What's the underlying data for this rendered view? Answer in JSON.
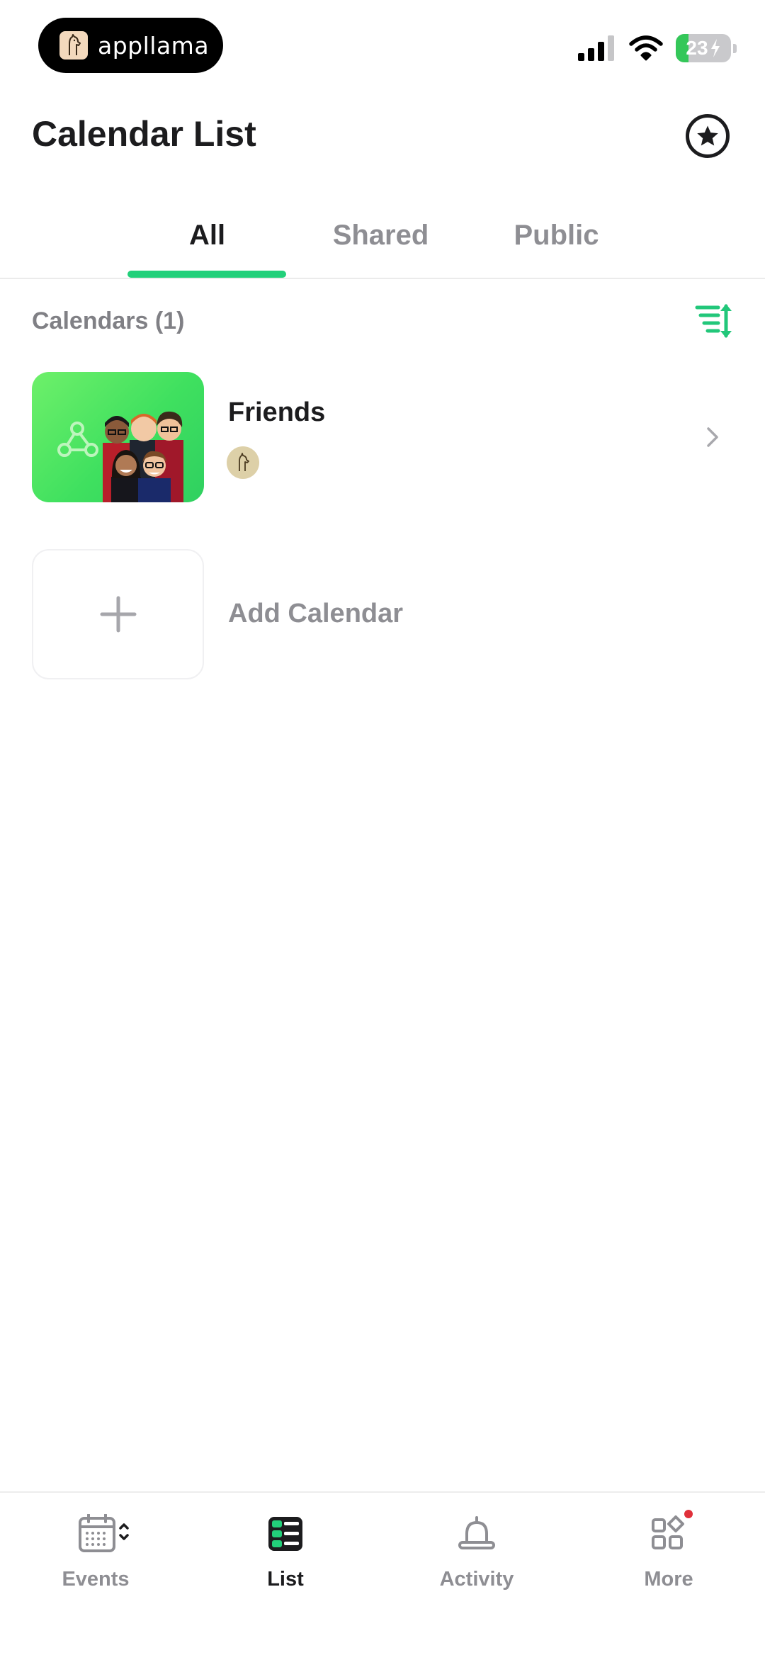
{
  "status_bar": {
    "app_badge": "appllama",
    "battery": "23",
    "battery_level_percent": 23,
    "battery_color": "#34c759"
  },
  "header": {
    "title": "Calendar List",
    "favorite_icon": "star-circle-icon"
  },
  "tabs": [
    {
      "label": "All",
      "active": true
    },
    {
      "label": "Shared",
      "active": false
    },
    {
      "label": "Public",
      "active": false
    }
  ],
  "accent_color": "#22d07a",
  "calendars": {
    "section_title": "Calendars (1)",
    "sort_icon": "sort-icon",
    "items": [
      {
        "name": "Friends",
        "thumbnail": "friends-group-illustration",
        "member_avatar": "llama-avatar",
        "chevron": "chevron-right-icon"
      }
    ],
    "add_label": "Add Calendar",
    "add_icon": "plus-icon"
  },
  "bottom_nav": [
    {
      "label": "Events",
      "icon": "calendar-icon",
      "active": false
    },
    {
      "label": "List",
      "icon": "list-icon",
      "active": true
    },
    {
      "label": "Activity",
      "icon": "bell-icon",
      "active": false
    },
    {
      "label": "More",
      "icon": "grid-icon",
      "active": false,
      "badge": true
    }
  ]
}
